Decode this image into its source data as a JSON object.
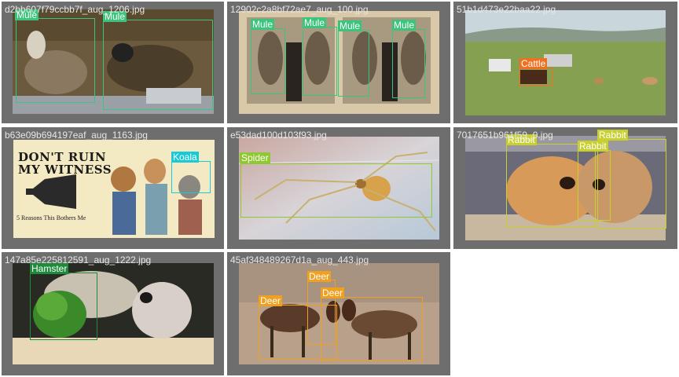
{
  "colors": {
    "tile_bg": "#6e6e6e",
    "mule": "#3cc47c",
    "cattle": "#f07020",
    "koala": "#19c9d6",
    "spider": "#8fc830",
    "rabbit": "#c8d030",
    "hamster": "#1e8a3a",
    "deer": "#f0a020"
  },
  "tiles": [
    {
      "filename": "d2bb607f79ccbb7f_aug_1206.jpg",
      "labels": [
        "Mule",
        "Mule"
      ]
    },
    {
      "filename": "12902c2a8bf72ae7_aug_100.jpg",
      "labels": [
        "Mule",
        "Mule",
        "Mule",
        "Mule"
      ]
    },
    {
      "filename": "51b1d473e22baa22.jpg",
      "labels": [
        "Cattle"
      ]
    },
    {
      "filename": "b63e09b694197eaf_aug_1163.jpg",
      "labels": [
        "Koala"
      ],
      "poster_title": "DON'T RUIN\nMY WITNESS",
      "poster_subtitle": "5 Reasons This Bothers Me"
    },
    {
      "filename": "e53dad100d103f93.jpg",
      "labels": [
        "Spider"
      ]
    },
    {
      "filename": "7017651b961f59_0.jpg",
      "labels": [
        "Rabbit",
        "Rabbit",
        "Rabbit"
      ]
    },
    {
      "filename": "147a85e225812591_aug_1222.jpg",
      "labels": [
        "Hamster"
      ]
    },
    {
      "filename": "45af348489267d1a_aug_443.jpg",
      "labels": [
        "Deer",
        "Deer",
        "Deer"
      ]
    }
  ]
}
